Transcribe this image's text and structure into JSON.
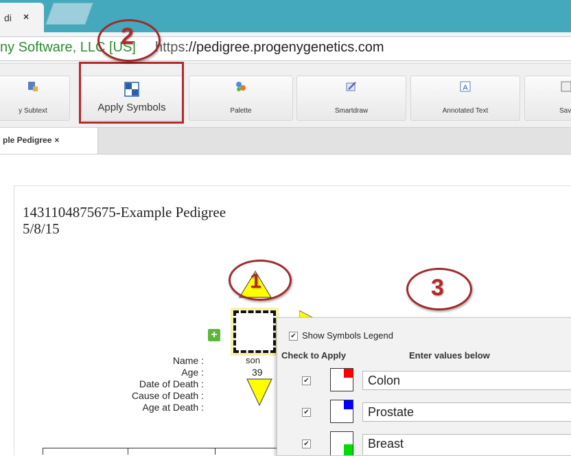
{
  "browser": {
    "tab_title": "di",
    "tab_close": "×",
    "ev_cert": "ny Software, LLC [US]",
    "url_scheme": "https",
    "url_rest": "://pedigree.progenygenetics.com"
  },
  "toolbar": {
    "buttons": [
      {
        "label": "y Subtext",
        "icon": "subtext-icon"
      },
      {
        "label": "Apply Symbols",
        "icon": "apply-symbols-icon"
      },
      {
        "label": "Palette",
        "icon": "palette-icon"
      },
      {
        "label": "Smartdraw",
        "icon": "smartdraw-icon"
      },
      {
        "label": "Annotated Text",
        "icon": "annotated-text-icon"
      },
      {
        "label": "Save",
        "icon": "save-icon"
      }
    ]
  },
  "doc_tab": {
    "label": "ple Pedigree",
    "close": "×"
  },
  "pedigree": {
    "title": "1431104875675-Example Pedigree",
    "date": "5/8/15",
    "patient": {
      "labels": [
        "Name :",
        "Age :",
        "Date of Death :",
        "Cause of Death :",
        "Age at Death :"
      ],
      "name_value": "son",
      "age_value": "39",
      "proband_marker": "1"
    }
  },
  "callouts": [
    "2",
    "1",
    "3"
  ],
  "symbols_panel": {
    "show_legend_label": "Show Symbols Legend",
    "show_legend_checked": true,
    "col_check": "Check to Apply",
    "col_values": "Enter values below",
    "rows": [
      {
        "checked": true,
        "color": "#ff0000",
        "value": "Colon"
      },
      {
        "checked": true,
        "color": "#0000ff",
        "value": "Prostate"
      },
      {
        "checked": true,
        "color": "#00dd00",
        "value": "Breast"
      }
    ]
  },
  "colors": {
    "tab_bar": "#45a9bd",
    "callout_red": "#b42828",
    "ev_green": "#2e8b2e",
    "marker_yellow": "#ffff00"
  }
}
